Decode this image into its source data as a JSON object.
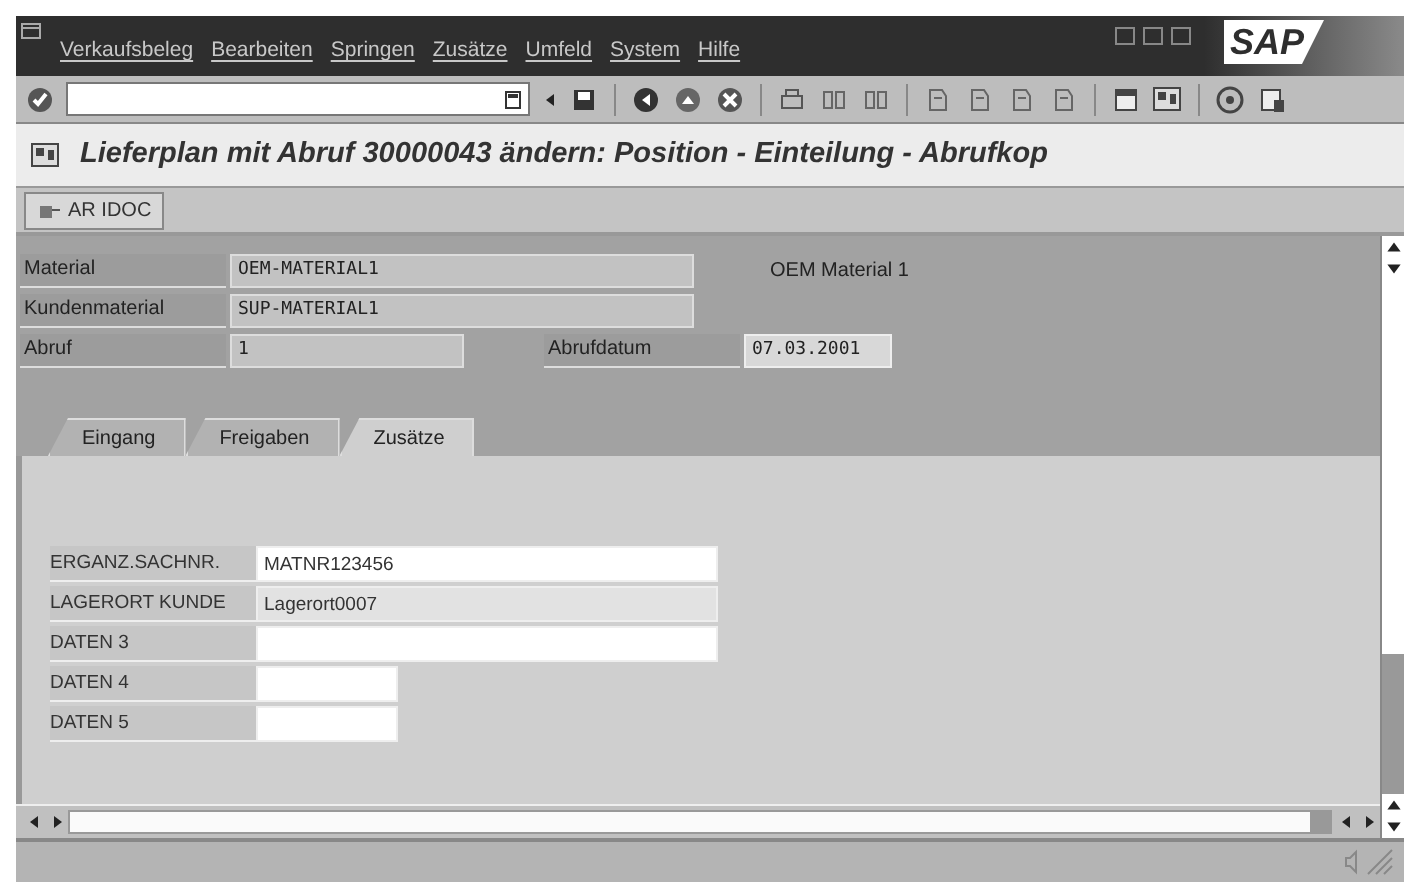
{
  "menu": [
    {
      "label": "Verkaufsbeleg"
    },
    {
      "label": "Bearbeiten"
    },
    {
      "label": "Springen"
    },
    {
      "label": "Zusätze"
    },
    {
      "label": "Umfeld"
    },
    {
      "label": "System"
    },
    {
      "label": "Hilfe"
    }
  ],
  "logo": "SAP",
  "title": "Lieferplan mit Abruf 30000043 ändern: Position - Einteilung - Abrufkop",
  "app_toolbar": [
    {
      "label": "AR IDOC"
    }
  ],
  "header": [
    [
      {
        "kind": "label",
        "text": "Material"
      },
      {
        "kind": "long",
        "text": "OEM-MATERIAL1"
      },
      {
        "kind": "text",
        "text": "OEM Material 1"
      }
    ],
    [
      {
        "kind": "label",
        "text": "Kundenmaterial"
      },
      {
        "kind": "long",
        "text": "SUP-MATERIAL1"
      }
    ],
    [
      {
        "kind": "label",
        "text": "Abruf"
      },
      {
        "kind": "short",
        "text": "1"
      },
      {
        "kind": "label",
        "text": "Abrufdatum"
      },
      {
        "kind": "date",
        "text": "07.03.2001"
      }
    ]
  ],
  "tabs": [
    {
      "label": "Eingang",
      "selected": false
    },
    {
      "label": "Freigaben",
      "selected": false
    },
    {
      "label": "Zusätze",
      "selected": true
    }
  ],
  "tab_fields": [
    {
      "label": "ERGANZ.SACHNR.",
      "value": "MATNR123456",
      "kind": "long",
      "focused": false
    },
    {
      "label": "LAGERORT KUNDE",
      "value": "Lagerort0007",
      "kind": "long",
      "focused": true
    },
    {
      "label": "DATEN 3",
      "kind": "long",
      "focused": false
    },
    {
      "label": "DATEN 4",
      "kind": "short",
      "focused": false
    },
    {
      "label": "DATEN 5",
      "kind": "short",
      "focused": false
    }
  ]
}
